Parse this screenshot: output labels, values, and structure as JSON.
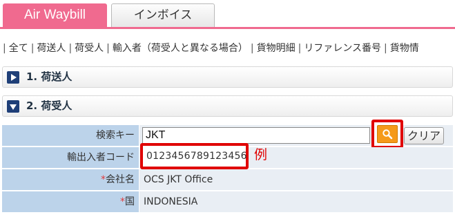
{
  "tabs": {
    "active": "Air Waybill",
    "inactive": "インボイス"
  },
  "section_links": [
    "全て",
    "荷送人",
    "荷受人",
    "輸入者（荷受人と異なる場合）",
    "貨物明細",
    "リファレンス番号",
    "貨物情"
  ],
  "sections": {
    "shipper": {
      "title": "1. 荷送人"
    },
    "consignee": {
      "title": "2. 荷受人"
    }
  },
  "form": {
    "search_key": {
      "label": "検索キー",
      "value": "JKT"
    },
    "clear_label": "クリア",
    "ie_code": {
      "label": "輸出入者コード",
      "value": "0123456789123456"
    },
    "example_note": "例",
    "company": {
      "required_mark": "*",
      "label": "会社名",
      "value": "OCS JKT Office"
    },
    "country": {
      "required_mark": "*",
      "label": "国",
      "value": "INDONESIA"
    }
  },
  "colors": {
    "tab_accent": "#f06a8f",
    "label_bg": "#bcd3ea",
    "value_bg": "#e9eef4",
    "highlight": "#e00000",
    "search_button": "#f59a1a",
    "toggle": "#1f3f78"
  },
  "icons": {
    "expand": "triangle-right-icon",
    "collapse": "triangle-down-icon",
    "search": "magnifier-icon"
  }
}
